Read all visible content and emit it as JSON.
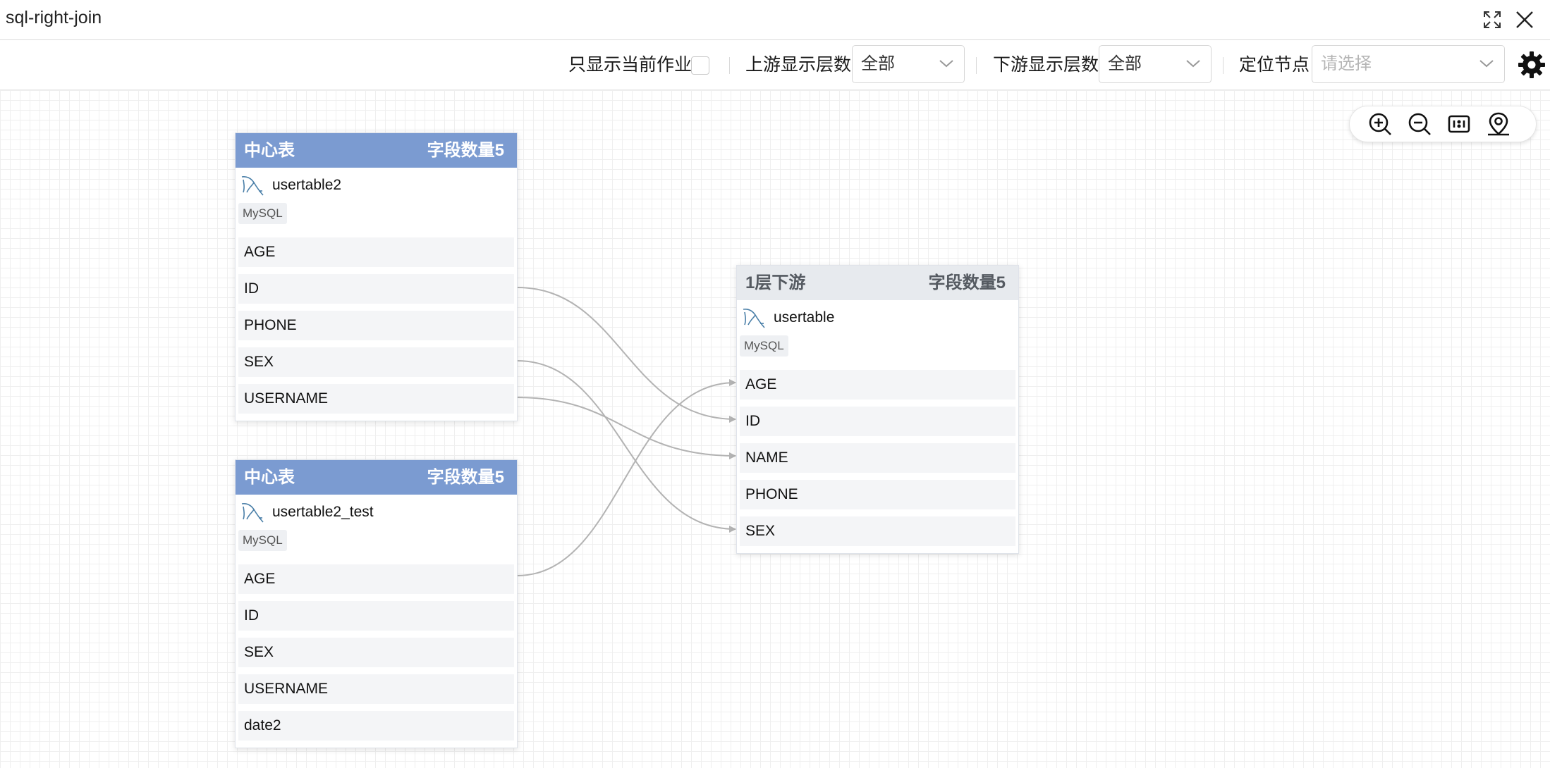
{
  "window": {
    "title": "sql-right-join"
  },
  "toolbar": {
    "only_current_job_label": "只显示当前作业",
    "upstream_label": "上游显示层数",
    "upstream_value": "全部",
    "downstream_label": "下游显示层数",
    "downstream_value": "全部",
    "locate_label": "定位节点",
    "locate_placeholder": "请选择"
  },
  "tables": {
    "center1": {
      "header": "中心表",
      "count": "字段数量5",
      "name": "usertable2",
      "db": "MySQL",
      "fields": [
        "AGE",
        "ID",
        "PHONE",
        "SEX",
        "USERNAME"
      ]
    },
    "center2": {
      "header": "中心表",
      "count": "字段数量5",
      "name": "usertable2_test",
      "db": "MySQL",
      "fields": [
        "AGE",
        "ID",
        "SEX",
        "USERNAME",
        "date2"
      ]
    },
    "downstream": {
      "header": "1层下游",
      "count": "字段数量5",
      "name": "usertable",
      "db": "MySQL",
      "fields": [
        "AGE",
        "ID",
        "NAME",
        "PHONE",
        "SEX"
      ]
    }
  },
  "lineage": [
    {
      "from": "usertable2.ID",
      "to": "usertable.ID"
    },
    {
      "from": "usertable2.SEX",
      "to": "usertable.SEX"
    },
    {
      "from": "usertable2.USERNAME",
      "to": "usertable.NAME"
    },
    {
      "from": "usertable2_test.AGE",
      "to": "usertable.AGE"
    }
  ],
  "colors": {
    "center_header": "#7b9bd1",
    "downstream_header": "#e7eaee",
    "link": "#b3b3b3"
  },
  "icons": {
    "expand": "expand-icon",
    "close": "close-icon",
    "settings": "gear-icon",
    "zoom_in": "zoom-in-icon",
    "zoom_out": "zoom-out-icon",
    "fit": "fit-view-icon",
    "locate": "locate-icon",
    "mysql": "mysql-dolphin-icon"
  }
}
